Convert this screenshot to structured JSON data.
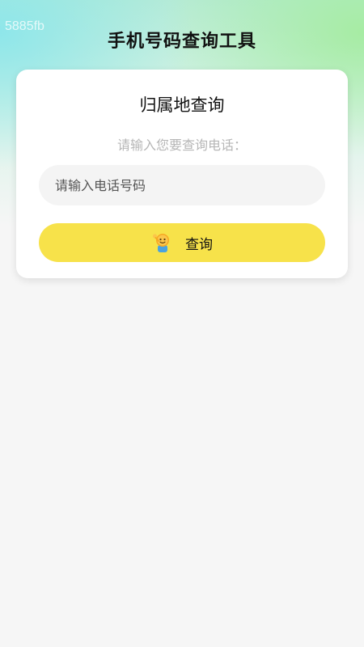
{
  "watermark": "5885fb",
  "header": {
    "title": "手机号码查询工具"
  },
  "card": {
    "title": "归属地查询",
    "hint": "请输入您要查询电话：",
    "input": {
      "placeholder": "请输入电话号码",
      "value": ""
    },
    "button": {
      "label": "查询",
      "icon": "waving-character-icon"
    }
  },
  "colors": {
    "button": "#f7e24a",
    "background": "#f6f6f6",
    "gradient_left": "#8ce6eb",
    "gradient_right": "#a5eca0"
  }
}
